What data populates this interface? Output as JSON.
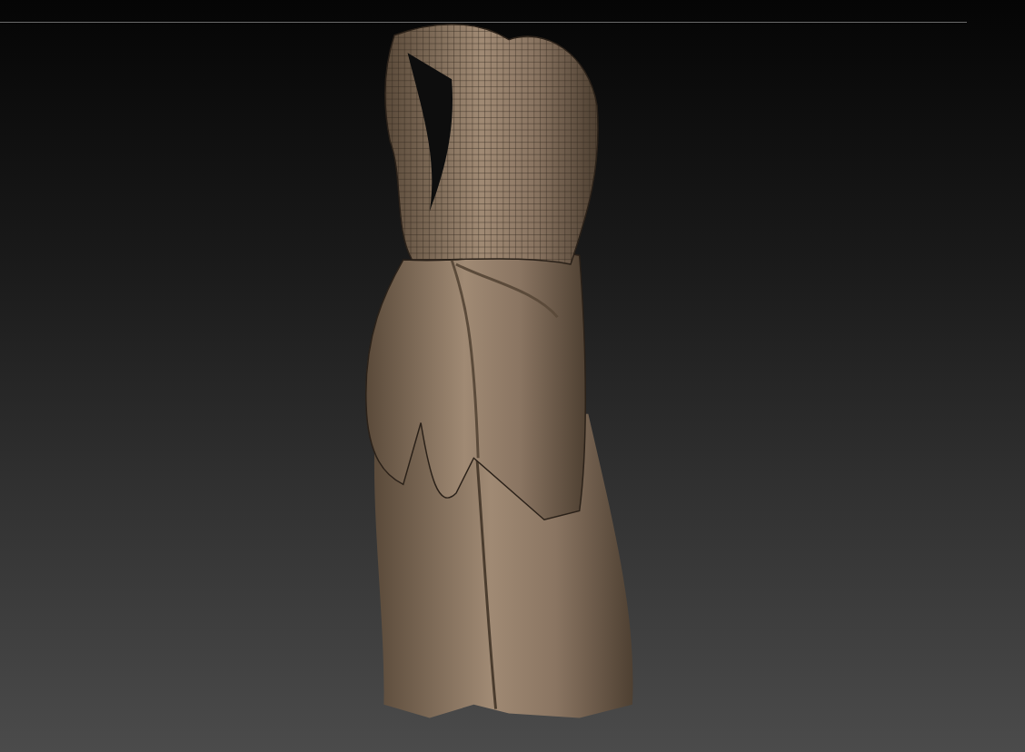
{
  "viewport": {
    "model": {
      "kind": "garment"
    }
  }
}
